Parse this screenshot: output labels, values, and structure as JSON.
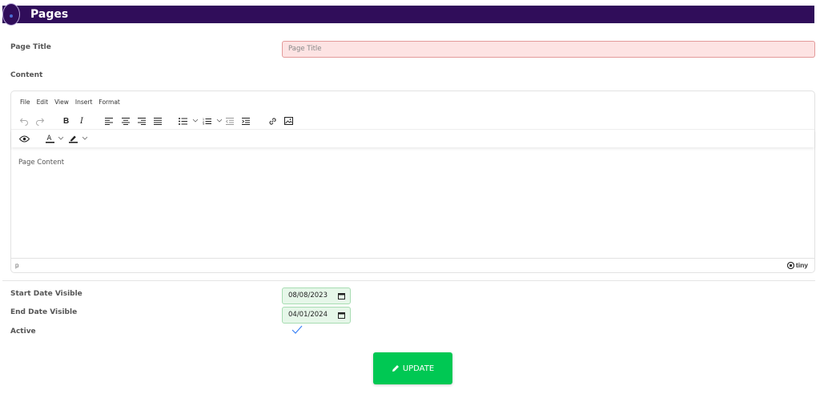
{
  "header": {
    "title": "Pages"
  },
  "form": {
    "page_title_label": "Page Title",
    "page_title_placeholder": "Page Title",
    "content_label": "Content",
    "start_date_label": "Start Date Visible",
    "start_date_value": "08/08/2023",
    "end_date_label": "End Date Visible",
    "end_date_value": "04/01/2024",
    "active_label": "Active",
    "active_checked": true,
    "update_label": "UPDATE"
  },
  "editor": {
    "menu": [
      "File",
      "Edit",
      "View",
      "Insert",
      "Format"
    ],
    "placeholder": "Page Content",
    "status_path": "p",
    "brand": "tiny",
    "toolbar_icons": [
      "undo-icon",
      "redo-icon",
      "bold-icon",
      "italic-icon",
      "align-left-icon",
      "align-center-icon",
      "align-right-icon",
      "align-justify-icon",
      "bullet-list-icon",
      "numbered-list-icon",
      "outdent-icon",
      "indent-icon",
      "link-icon",
      "image-icon",
      "preview-icon",
      "text-color-icon",
      "highlight-icon"
    ]
  },
  "colors": {
    "header_bg": "#300d5a",
    "title_input_bg": "#fde3e3",
    "date_input_bg": "#e6f7e9",
    "update_bg": "#00c853",
    "check": "#3b82f6"
  }
}
